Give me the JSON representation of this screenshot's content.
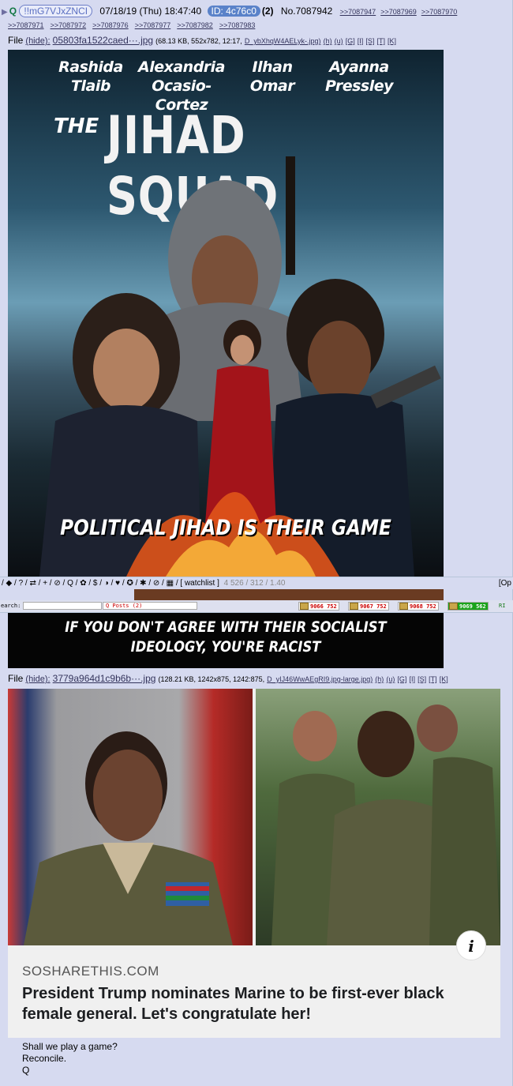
{
  "post": {
    "name": "Q",
    "tripcode": "!!mG7VJxZNCI",
    "datetime": "07/18/19 (Thu) 18:47:40",
    "id_label": "ID: 4c76c0",
    "id_count": "(2)",
    "number": "No.7087942",
    "backlinks_row1": [
      ">>7087947",
      ">>7087969",
      ">>7087970"
    ],
    "backlinks_row2": [
      ">>7087971",
      ">>7087972",
      ">>7087976",
      ">>7087977",
      ">>7087982",
      ">>7087983"
    ]
  },
  "file1": {
    "label": "File",
    "hide": "(hide):",
    "filename": "05803fa1522caed···.jpg",
    "meta": "(68.13 KB, 552x782, 12:17,",
    "original": "D_ybXhqW4AELyk-.jpg)",
    "links": [
      "(h)",
      "(u)",
      "[G]",
      "[I]",
      "[S]",
      "[T]",
      "[K]"
    ]
  },
  "poster": {
    "names": [
      {
        "first": "Rashida",
        "last": "Tlaib"
      },
      {
        "first": "Alexandria",
        "last": "Ocasio-Cortez"
      },
      {
        "first": "Ilhan",
        "last": "Omar"
      },
      {
        "first": "Ayanna",
        "last": "Pressley"
      }
    ],
    "the": "THE",
    "title": "JIHAD SQUAD",
    "slogan": "POLITICAL JIHAD IS THEIR GAME",
    "slogan2_line1": "IF YOU DON'T AGREE WITH THEIR SOCIALIST",
    "slogan2_line2": "IDEOLOGY, YOU'RE RACIST"
  },
  "navbar": {
    "icons": "/ ◆ / ? / ⇄ / + / ⊘ / Q / ✿ / $ / ◑ / ♥ / ✪ / ✱ / ⊘ / ▦ /",
    "watchlist": "[ watchlist ]",
    "stats": "4 526 / 312 / 1.40",
    "options": "[Op"
  },
  "qbar": {
    "search_label": "earch:",
    "qposts": "Q Posts (2)",
    "chips": [
      {
        "a": "9066",
        "b": "752",
        "active": false
      },
      {
        "a": "9067",
        "b": "752",
        "active": false
      },
      {
        "a": "9068",
        "b": "752",
        "active": false
      },
      {
        "a": "9069",
        "b": "562",
        "active": true
      }
    ],
    "right": "RI"
  },
  "file2": {
    "label": "File",
    "hide": "(hide):",
    "filename": "3779a964d1c9b6b···.jpg",
    "meta": "(128.21 KB, 1242x875, 1242:875,",
    "original": "D_yIJ46WwAEgRI9.jpg-large.jpg)",
    "links": [
      "(h)",
      "(u)",
      "[G]",
      "[I]",
      "[S]",
      "[T]",
      "[K]"
    ]
  },
  "card": {
    "domain": "SOSHARETHIS.COM",
    "headline": "President Trump nominates Marine to be first-ever black female general. Let's congratulate her!",
    "info_glyph": "i"
  },
  "comment": [
    "Shall we play a game?",
    "Reconcile.",
    "Q"
  ]
}
